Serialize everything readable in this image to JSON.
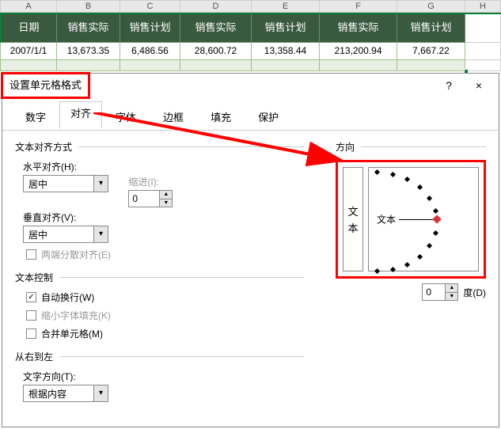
{
  "columns": [
    "A",
    "B",
    "C",
    "D",
    "E",
    "F",
    "G",
    "H"
  ],
  "header_row": [
    "日期",
    "销售实际",
    "销售计划",
    "销售实际",
    "销售计划",
    "销售实际",
    "销售计划"
  ],
  "row1": [
    "2007/1/1",
    "13,673.35",
    "6,486.56",
    "28,600.72",
    "13,358.44",
    "213,200.94",
    "7,667.22"
  ],
  "dialog": {
    "title": "设置单元格格式",
    "help": "?",
    "close": "×",
    "tabs": [
      "数字",
      "对齐",
      "字体",
      "边框",
      "填充",
      "保护"
    ],
    "active_tab": "对齐",
    "text_align_section": "文本对齐方式",
    "h_align_label": "水平对齐(H):",
    "h_align_value": "居中",
    "indent_label": "缩进(I):",
    "indent_value": "0",
    "v_align_label": "垂直对齐(V):",
    "v_align_value": "居中",
    "justify_dist": "两端分散对齐(E)",
    "text_control_section": "文本控制",
    "wrap_text": "自动换行(W)",
    "shrink_fit": "缩小字体填充(K)",
    "merge_cells": "合并单元格(M)",
    "rtl_section": "从右到左",
    "text_dir_label": "文字方向(T):",
    "text_dir_value": "根据内容",
    "orientation_section": "方向",
    "orient_vert1": "文",
    "orient_vert2": "本",
    "orient_center_text": "文本",
    "deg_value": "0",
    "deg_label": "度(D)"
  }
}
